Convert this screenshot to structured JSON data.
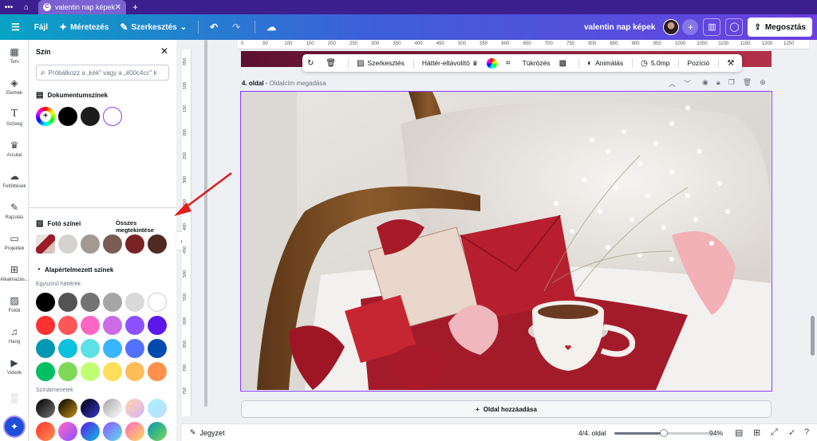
{
  "browser": {
    "tab_title": "valentin nap képek",
    "tab_logo": "C",
    "icons": [
      "more-horizontal-icon",
      "home-icon",
      "close-icon",
      "plus-icon"
    ]
  },
  "topbar": {
    "menu_icon": "hamburger-icon",
    "file_label": "Fájl",
    "resize_label": "Méretezés",
    "edit_label": "Szerkesztés",
    "doc_name": "valentin nap képek",
    "share_label": "Megosztás",
    "brand_gradient": [
      "#08a3c4",
      "#3d5fd9",
      "#6c3fe0"
    ]
  },
  "leftnav": {
    "items": [
      {
        "icon": "template-icon",
        "label": "Terv"
      },
      {
        "icon": "elements-icon",
        "label": "Elemek"
      },
      {
        "icon": "text-icon",
        "label": "Szöveg"
      },
      {
        "icon": "brand-icon",
        "label": "Arculat"
      },
      {
        "icon": "upload-icon",
        "label": "Feltöltések"
      },
      {
        "icon": "draw-icon",
        "label": "Rajzolás"
      },
      {
        "icon": "folder-icon",
        "label": "Projektek"
      },
      {
        "icon": "apps-icon",
        "label": "Alkalmazás..."
      },
      {
        "icon": "photo-icon",
        "label": "Fotók"
      },
      {
        "icon": "music-icon",
        "label": "Hang"
      },
      {
        "icon": "video-icon",
        "label": "Videók"
      }
    ]
  },
  "panel": {
    "title": "Szín",
    "search_placeholder": "Próbálkozz a „kék\" vagy a „#00c4cc\" k",
    "doc_colors_label": "Dokumentumszínek",
    "doc_colors": [
      "#000000",
      "#1c1c1c",
      "#ffffff"
    ],
    "photo_colors_label": "Fotó színei",
    "see_all": "Összes megtekintése",
    "photo_colors": [
      "#d4d3d1",
      "#a49893",
      "#7a5c52",
      "#7a2325",
      "#4e2a22"
    ],
    "default_colors_label": "Alapértelmezett színek",
    "solid_label": "Egyszínű háttérek",
    "solid_colors": [
      [
        "#000000",
        "#545454",
        "#737373",
        "#a6a6a6",
        "#d9d9d9",
        "#ffffff"
      ],
      [
        "#ff3131",
        "#ff5757",
        "#ff66c4",
        "#cb6ce6",
        "#8c52ff",
        "#5e17eb"
      ],
      [
        "#0097b2",
        "#0cc0df",
        "#5ce1e6",
        "#38b6ff",
        "#5271ff",
        "#004aad"
      ],
      [
        "#00bf63",
        "#7ed957",
        "#c1ff72",
        "#ffde59",
        "#ffbd59",
        "#ff914d"
      ]
    ],
    "gradient_label": "Színátmenetek"
  },
  "rulers": {
    "top": [
      "0",
      "50",
      "100",
      "150",
      "200",
      "250",
      "300",
      "350",
      "400",
      "450",
      "500",
      "550",
      "600",
      "650",
      "700",
      "750",
      "800",
      "850",
      "900",
      "950",
      "1000",
      "1050",
      "1100",
      "1150",
      "1200",
      "1250"
    ],
    "left": [
      "050",
      "100",
      "150",
      "200",
      "250",
      "300",
      "350",
      "400",
      "450",
      "500",
      "550",
      "600",
      "650",
      "700",
      "750"
    ]
  },
  "context_toolbar": {
    "edit_label": "Szerkesztés",
    "bg_remover_label": "Háttér-eltávolító",
    "flip_label": "Tükrözés",
    "animate_label": "Animálás",
    "duration_label": "5.0mp",
    "position_label": "Pozíció"
  },
  "page": {
    "number_label": "4. oldal",
    "title_placeholder": "Oldalcím megadása",
    "add_page_label": "Oldal hozzáadása"
  },
  "bottombar": {
    "notes_label": "Jegyzet",
    "page_count": "4/4. oldal",
    "zoom": "94%",
    "zoom_fraction": 0.52
  },
  "accent": "#8b3dff"
}
